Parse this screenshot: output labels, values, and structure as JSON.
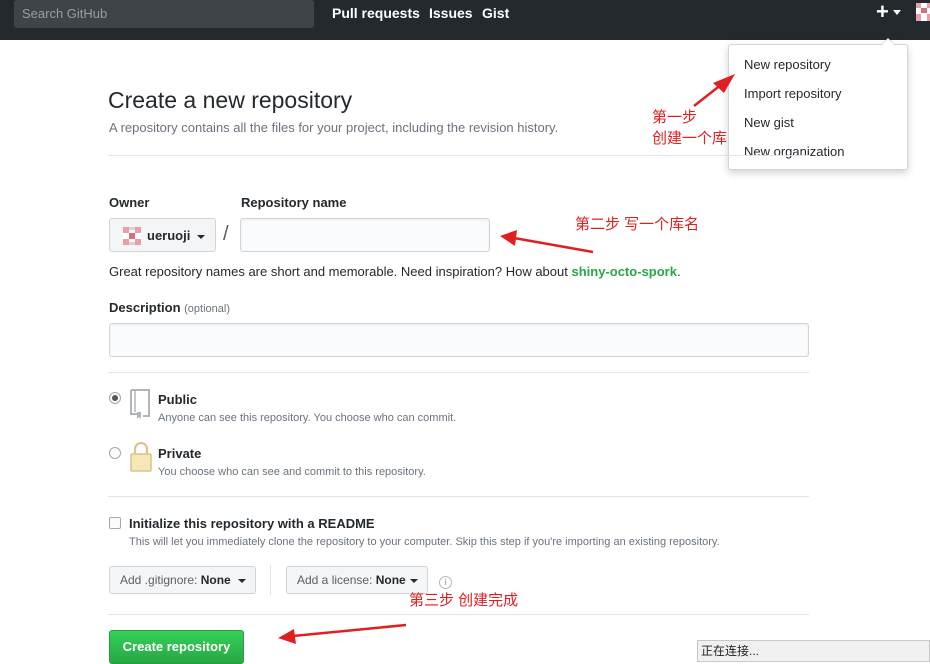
{
  "header": {
    "search_placeholder": "Search GitHub",
    "nav": [
      "Pull requests",
      "Issues",
      "Gist"
    ],
    "plus_symbol": "+"
  },
  "dropdown": {
    "items": [
      "New repository",
      "Import repository",
      "New gist",
      "New organization"
    ]
  },
  "page": {
    "title": "Create a new repository",
    "subtitle": "A repository contains all the files for your project, including the revision history."
  },
  "form": {
    "owner_label": "Owner",
    "owner_value": "ueruoji",
    "repo_name_label": "Repository name",
    "repo_name_value": "",
    "slash": "/",
    "hint_prefix": "Great repository names are short and memorable. Need inspiration? How about ",
    "hint_suggestion": "shiny-octo-spork",
    "hint_suffix": ".",
    "description_label": "Description",
    "description_optional": "(optional)",
    "description_value": "",
    "public_title": "Public",
    "public_desc": "Anyone can see this repository. You choose who can commit.",
    "private_title": "Private",
    "private_desc": "You choose who can see and commit to this repository.",
    "visibility_selected": "Public",
    "readme_label": "Initialize this repository with a README",
    "readme_desc": "This will let you immediately clone the repository to your computer. Skip this step if you're importing an existing repository.",
    "readme_checked": false,
    "gitignore_prefix": "Add .gitignore:",
    "gitignore_value": "None",
    "license_prefix": "Add a license:",
    "license_value": "None",
    "info_symbol": "i",
    "create_button": "Create repository"
  },
  "annotations": {
    "step1_line1": "第一步",
    "step1_line2": "创建一个库",
    "step2": "第二步 写一个库名",
    "step3": "第三步 创建完成"
  },
  "status_bar": "正在连接...",
  "colors": {
    "header_bg": "#24292e",
    "create_button": "#28a745",
    "suggestion": "#28a745",
    "annotation": "#e02020"
  }
}
